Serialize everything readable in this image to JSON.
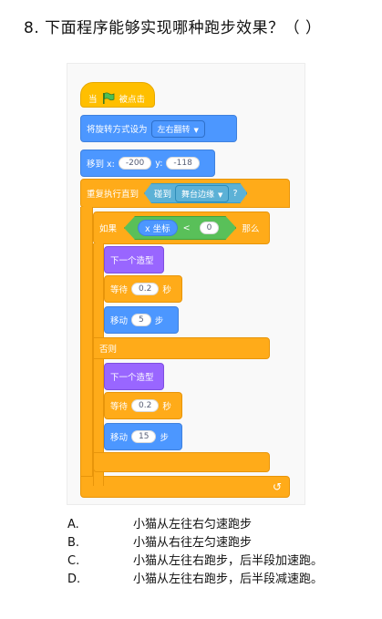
{
  "question": "8. 下面程序能够实现哪种跑步效果？（ ）",
  "script": {
    "when_flag": "当",
    "when_flag_suffix": "被点击",
    "flag_icon": "green-flag-icon",
    "set_rotation": "将旋转方式设为",
    "rotation_value": "左右翻转",
    "goto_label": "移到 x:",
    "goto_x": "-200",
    "goto_y_label": "y:",
    "goto_y": "-118",
    "repeat_until": "重复执行直到",
    "touching": "碰到",
    "touching_target": "舞台边缘",
    "touching_q": "?",
    "if_label": "如果",
    "x_position": "x 坐标",
    "lt": "<",
    "compare_value": "0",
    "then_label": "那么",
    "next_costume_1": "下一个造型",
    "wait_1": "等待",
    "wait_1_value": "0.2",
    "wait_1_unit": "秒",
    "move_1": "移动",
    "move_1_value": "5",
    "move_1_unit": "步",
    "else_label": "否则",
    "next_costume_2": "下一个造型",
    "wait_2": "等待",
    "wait_2_value": "0.2",
    "wait_2_unit": "秒",
    "move_2": "移动",
    "move_2_value": "15",
    "move_2_unit": "步",
    "loop_arrow": "↺"
  },
  "options": [
    {
      "key": "A.",
      "text": "小猫从左往右匀速跑步"
    },
    {
      "key": "B.",
      "text": "小猫从右往左匀速跑步"
    },
    {
      "key": "C.",
      "text": "小猫从左往右跑步，后半段加速跑。"
    },
    {
      "key": "D.",
      "text": "小猫从左往右跑步，后半段减速跑。"
    }
  ],
  "colors": {
    "motion": "#4c97ff",
    "control": "#ffab19",
    "looks": "#9966ff",
    "sensing": "#5cb1d6",
    "operators": "#59c059",
    "events": "#ffbf00"
  }
}
